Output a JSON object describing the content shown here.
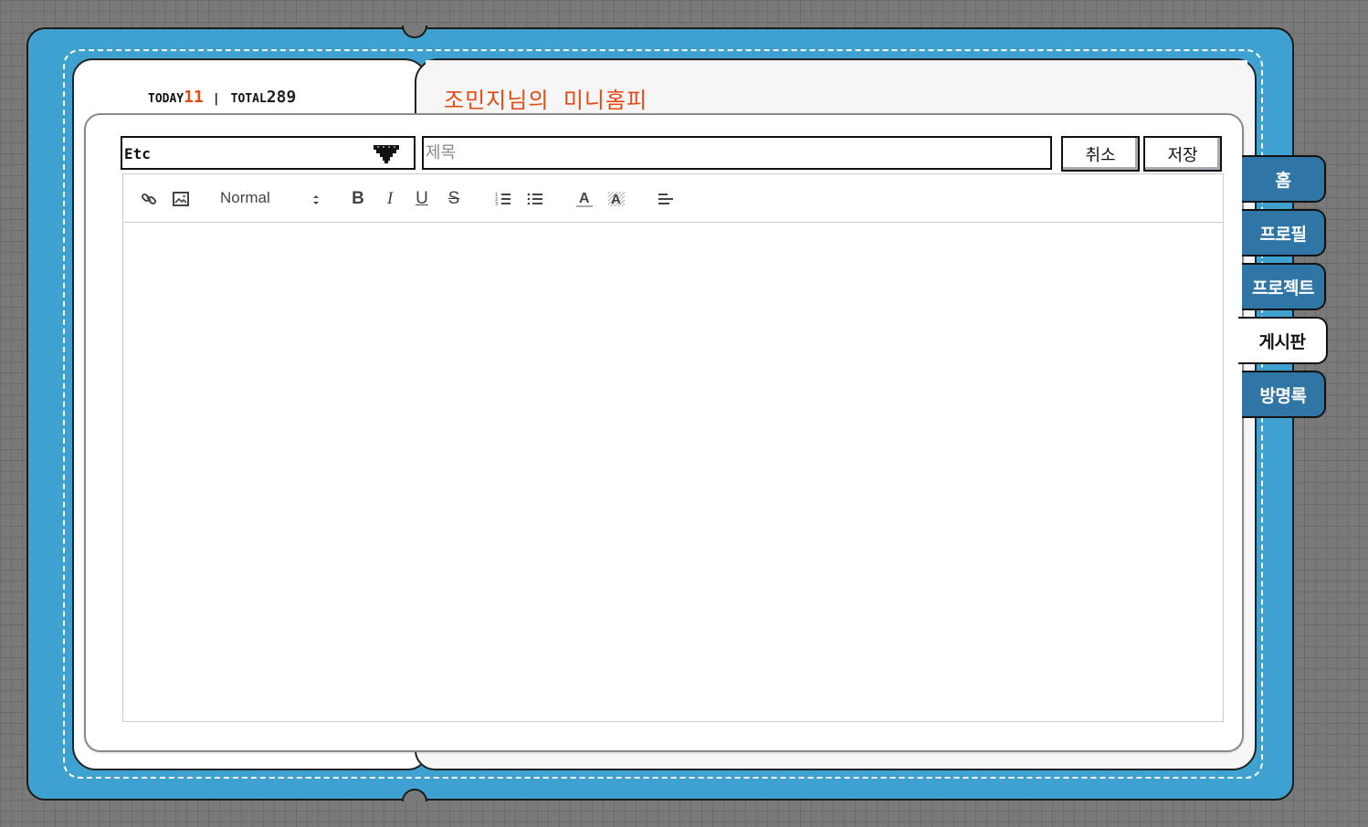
{
  "visitor_counter": {
    "today_label": "TODAY",
    "today_value": "11",
    "separator": "|",
    "total_label": "TOTAL",
    "total_value": "289"
  },
  "site_title": "조민지님의 미니홈피",
  "post_form": {
    "category": {
      "value": "Etc",
      "icon": "chevron-down-icon"
    },
    "title_input": {
      "value": "",
      "placeholder": "제목"
    },
    "cancel_label": "취소",
    "save_label": "저장"
  },
  "editor_toolbar": {
    "header_select": "Normal",
    "bold": "B",
    "italic": "I",
    "underline": "U",
    "strike": "S",
    "icons": [
      "link-icon",
      "image-icon",
      "ordered-list-icon",
      "bullet-list-icon",
      "text-color-icon",
      "background-color-icon",
      "align-left-icon"
    ]
  },
  "nav_tabs": [
    {
      "label": "홈",
      "active": false
    },
    {
      "label": "프로필",
      "active": false
    },
    {
      "label": "프로젝트",
      "active": false
    },
    {
      "label": "게시판",
      "active": true
    },
    {
      "label": "방명록",
      "active": false
    }
  ],
  "colors": {
    "frame": "#3fa1cf",
    "tab": "#2f76a6",
    "accent": "#e64a14",
    "background": "#7a7a7a"
  }
}
